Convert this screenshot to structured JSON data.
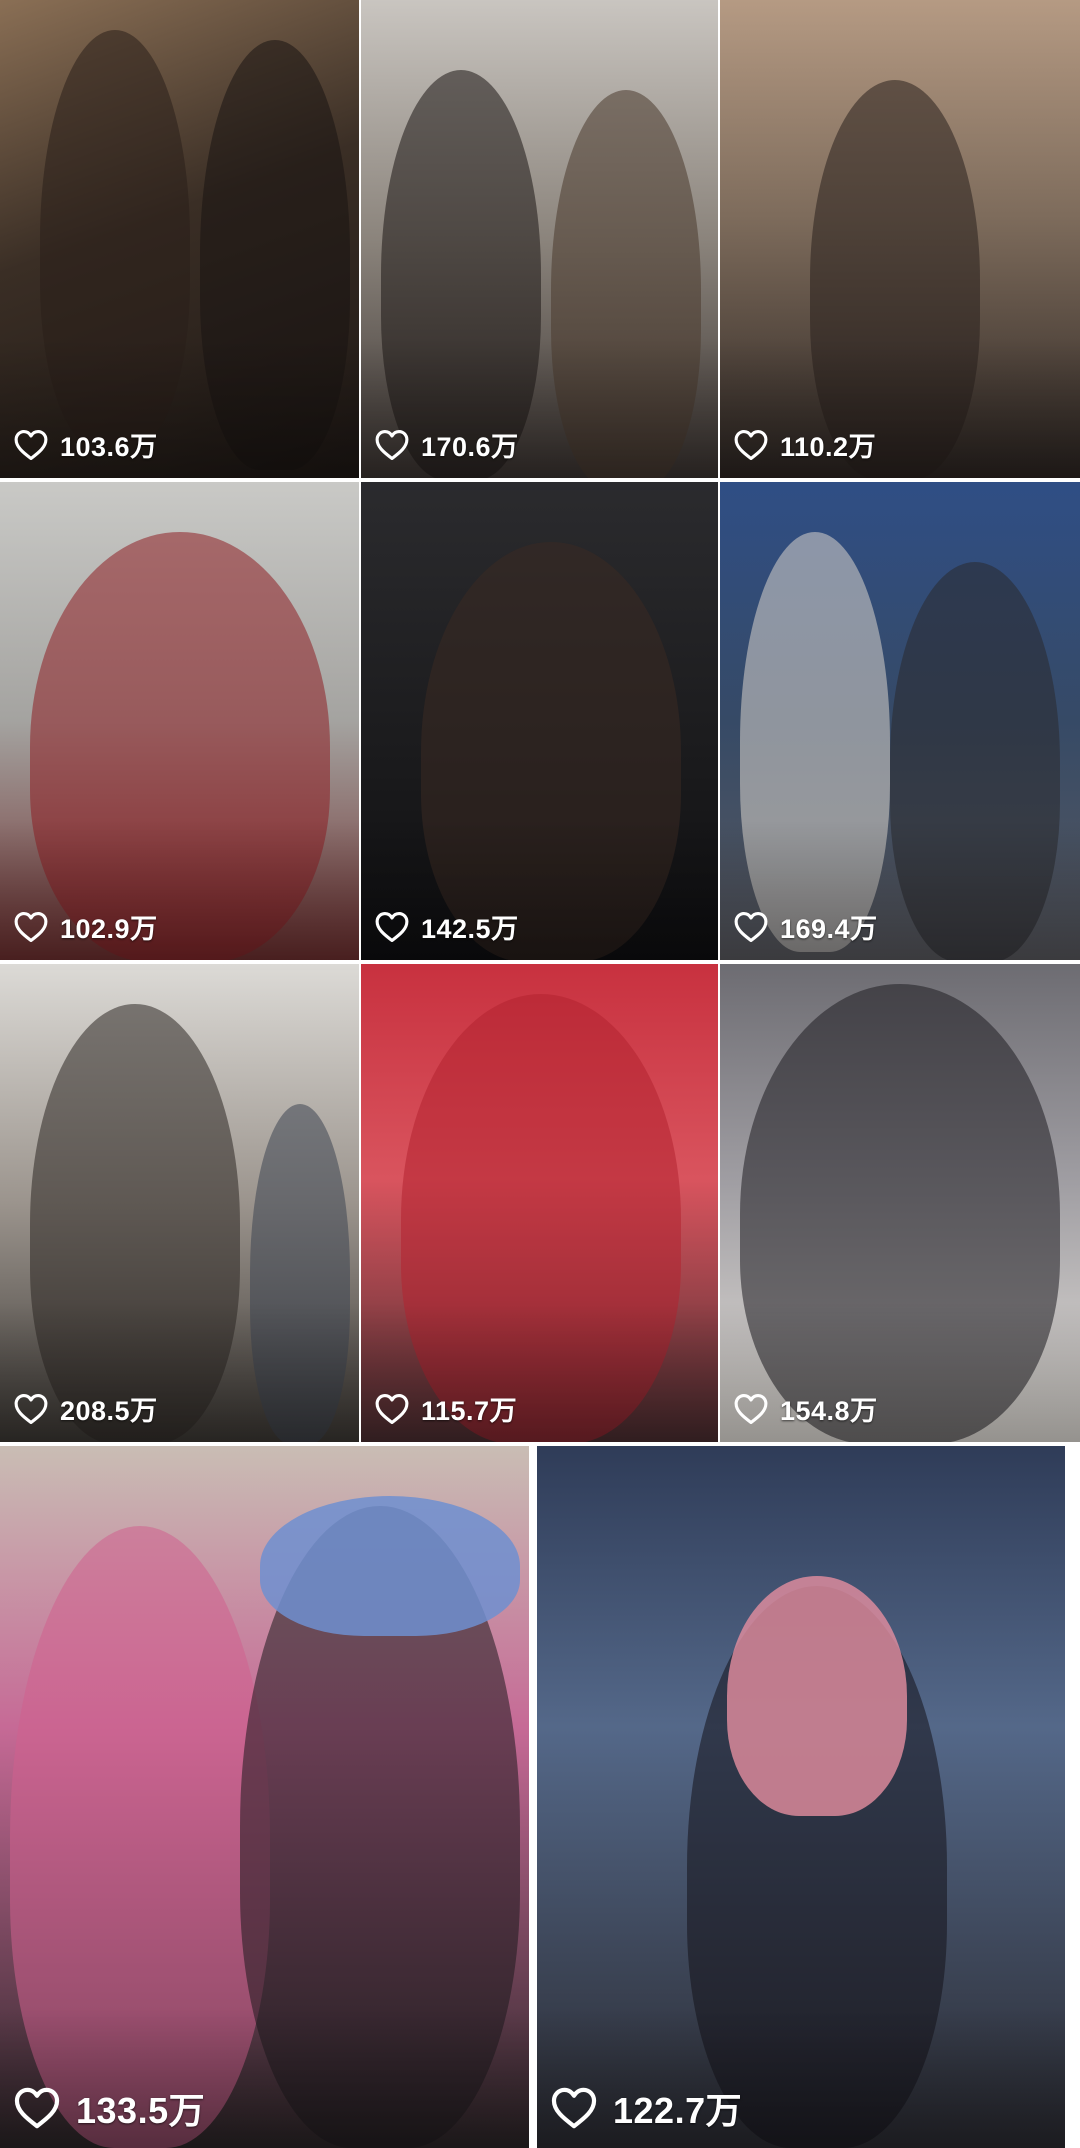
{
  "feed": {
    "like_icon": "heart-outline-icon",
    "text_color": "#ffffff",
    "items": [
      {
        "likes": "103.6万"
      },
      {
        "likes": "170.6万"
      },
      {
        "likes": "110.2万"
      },
      {
        "likes": "102.9万"
      },
      {
        "likes": "142.5万"
      },
      {
        "likes": "169.4万"
      },
      {
        "likes": "208.5万"
      },
      {
        "likes": "115.7万"
      },
      {
        "likes": "154.8万"
      },
      {
        "likes": "133.5万"
      },
      {
        "likes": "122.7万"
      }
    ]
  }
}
